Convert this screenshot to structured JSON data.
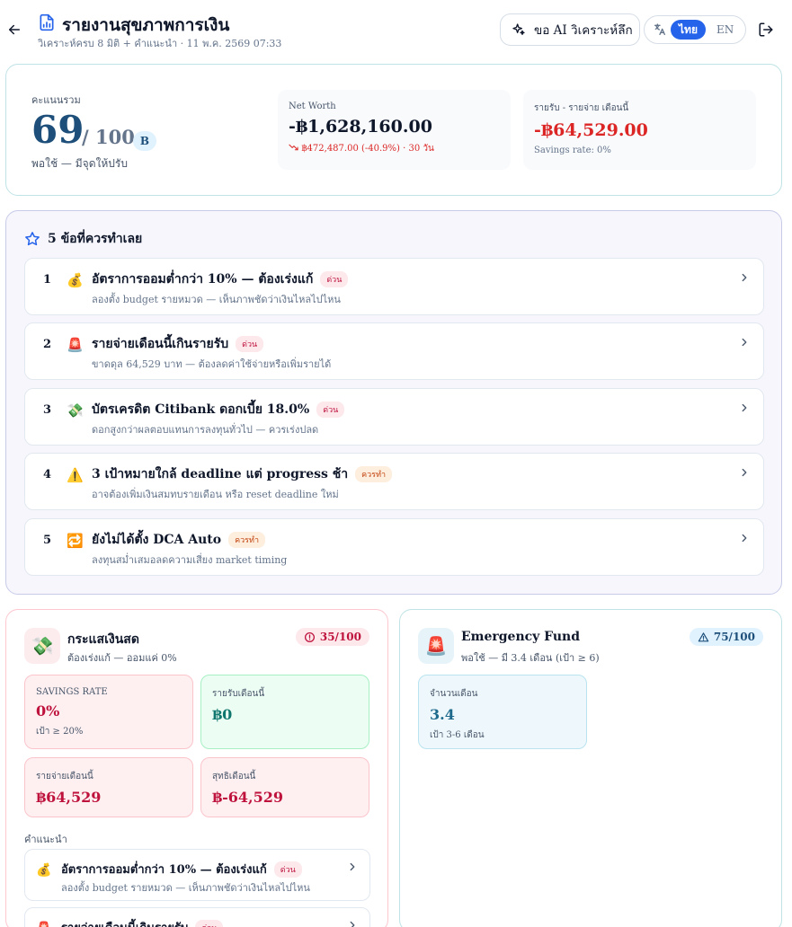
{
  "header": {
    "title": "รายงานสุขภาพการเงิน",
    "subtitle": "วิเคราะห์ครบ 8 มิติ + คำแนะนำ · 11 พ.ค. 2569 07:33",
    "ai_button_label": "ขอ AI วิเคราะห์ลึก",
    "lang_active": "ไทย",
    "lang_other": "EN"
  },
  "score": {
    "label": "คะแนนรวม",
    "value": "69",
    "max": "/ 100",
    "grade": "B",
    "description": "พอใช้ — มีจุดให้ปรับ"
  },
  "net_worth": {
    "label": "Net Worth",
    "value": "-฿1,628,160.00",
    "change": "฿472,487.00 (-40.9%) · 30 วัน"
  },
  "cashflow_summary": {
    "label": "รายรับ - รายจ่าย เดือนนี้",
    "value": "-฿64,529.00",
    "note": "Savings rate: 0%"
  },
  "actions": {
    "title": "5 ข้อที่ควรทำเลย",
    "items": [
      {
        "num": "1",
        "icon": "money-bag-icon",
        "emoji": "💰",
        "title": "อัตราการออมต่ำกว่า 10% — ต้องเร่งแก้",
        "badge": "ด่วน",
        "badge_type": "urgent",
        "sub": "ลองตั้ง budget รายหมวด — เห็นภาพชัดว่าเงินไหลไปไหน"
      },
      {
        "num": "2",
        "icon": "siren-icon",
        "emoji": "🚨",
        "title": "รายจ่ายเดือนนี้เกินรายรับ",
        "badge": "ด่วน",
        "badge_type": "urgent",
        "sub": "ขาดดุล 64,529 บาท — ต้องลดค่าใช้จ่ายหรือเพิ่มรายได้"
      },
      {
        "num": "3",
        "icon": "money-wings-icon",
        "emoji": "💸",
        "title": "บัตรเครดิต Citibank ดอกเบี้ย 18.0%",
        "badge": "ด่วน",
        "badge_type": "urgent",
        "sub": "ดอกสูงกว่าผลตอบแทนการลงทุนทั่วไป — ควรเร่งปลด"
      },
      {
        "num": "4",
        "icon": "warning-icon",
        "emoji": "⚠️",
        "title": "3 เป้าหมายใกล้ deadline แต่ progress ช้า",
        "badge": "ควรทำ",
        "badge_type": "should",
        "sub": "อาจต้องเพิ่มเงินสมทบรายเดือน หรือ reset deadline ใหม่"
      },
      {
        "num": "5",
        "icon": "repeat-icon",
        "emoji": "🔁",
        "title": "ยังไม่ได้ตั้ง DCA Auto",
        "badge": "ควรทำ",
        "badge_type": "should",
        "sub": "ลงทุนสม่ำเสมอลดความเสี่ยง market timing"
      }
    ]
  },
  "cashflow_card": {
    "name": "กระแสเงินสด",
    "status": "ต้องเร่งแก้ — ออมแค่ 0%",
    "score": "35/100",
    "tiles": [
      {
        "label": "SAVINGS RATE",
        "value": "0%",
        "note": "เป้า ≥ 20%"
      },
      {
        "label": "รายรับเดือนนี้",
        "value": "฿0"
      },
      {
        "label": "รายจ่ายเดือนนี้",
        "value": "฿64,529"
      },
      {
        "label": "สุทธิเดือนนี้",
        "value": "฿-64,529"
      }
    ],
    "rec_label": "คำแนะนำ",
    "recs": [
      {
        "emoji": "💰",
        "title": "อัตราการออมต่ำกว่า 10% — ต้องเร่งแก้",
        "badge": "ด่วน",
        "sub": "ลองตั้ง budget รายหมวด — เห็นภาพชัดว่าเงินไหลไปไหน"
      },
      {
        "emoji": "🚨",
        "title": "รายจ่ายเดือนนี้เกินรายรับ",
        "badge": "ด่วน"
      }
    ]
  },
  "emergency_card": {
    "name": "Emergency Fund",
    "status": "พอใช้ — มี 3.4 เดือน (เป้า ≥ 6)",
    "score": "75/100",
    "tiles": [
      {
        "label": "จำนวนเดือน",
        "value": "3.4",
        "note": "เป้า 3-6 เดือน"
      }
    ]
  },
  "colors": {
    "accent": "#2563eb",
    "negative": "#dc2626",
    "urgent": "#be123c",
    "positive": "#0f766e"
  }
}
